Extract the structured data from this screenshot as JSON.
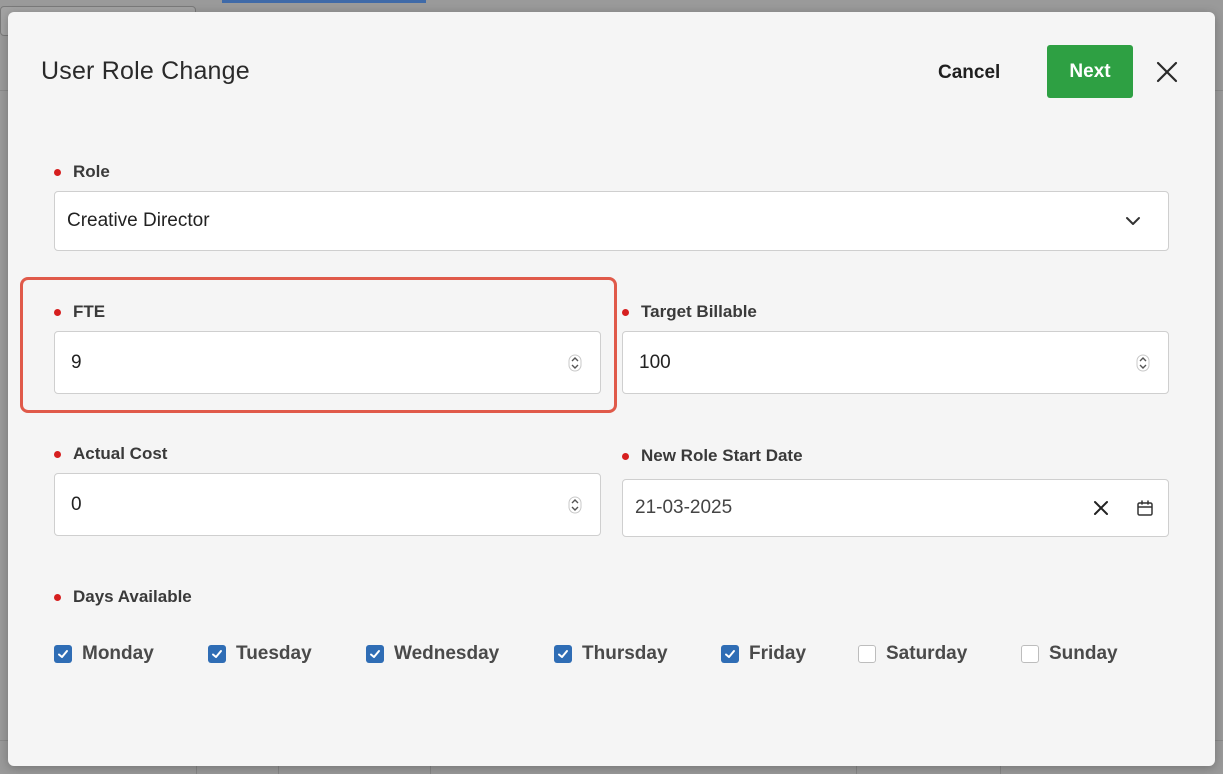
{
  "modal": {
    "title": "User Role Change",
    "cancel_label": "Cancel",
    "next_label": "Next"
  },
  "fields": {
    "role": {
      "label": "Role",
      "value": "Creative Director"
    },
    "fte": {
      "label": "FTE",
      "value": "9"
    },
    "target_billable": {
      "label": "Target Billable",
      "value": "100"
    },
    "actual_cost": {
      "label": "Actual Cost",
      "value": "0"
    },
    "new_role_start_date": {
      "label": "New Role Start Date",
      "value": "21-03-2025"
    },
    "days_available": {
      "label": "Days Available"
    }
  },
  "days": [
    {
      "label": "Monday",
      "checked": true
    },
    {
      "label": "Tuesday",
      "checked": true
    },
    {
      "label": "Wednesday",
      "checked": true
    },
    {
      "label": "Thursday",
      "checked": true
    },
    {
      "label": "Friday",
      "checked": true
    },
    {
      "label": "Saturday",
      "checked": false
    },
    {
      "label": "Sunday",
      "checked": false
    }
  ],
  "colors": {
    "accent_green": "#2ea043",
    "checkbox_blue": "#2f6db5",
    "required_dot": "#d61f1f",
    "highlight_border": "#e05a4a"
  },
  "icons": [
    "close-icon",
    "chevron-down-icon",
    "spinner-icon",
    "clear-icon",
    "calendar-icon",
    "check-icon"
  ]
}
